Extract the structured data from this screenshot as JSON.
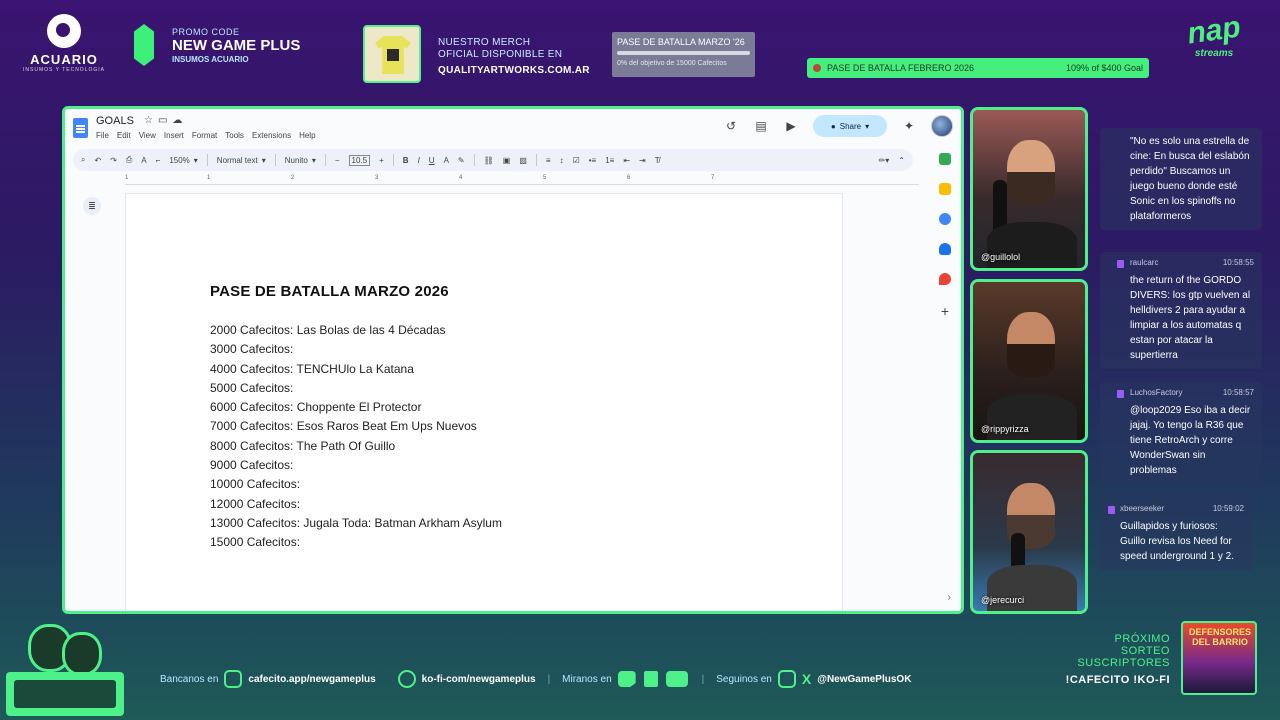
{
  "overlay": {
    "sponsor": {
      "name": "ACUARIO",
      "tagline": "INSUMOS Y TECNOLOGIA"
    },
    "promo": {
      "label": "PROMO CODE",
      "code": "NEW GAME PLUS",
      "sub": "INSUMOS ACUARIO"
    },
    "merch": {
      "line1": "NUESTRO MERCH",
      "line2": "OFICIAL DISPONIBLE EN",
      "url": "QUALITYARTWORKS.COM.AR"
    },
    "goal_card": {
      "title": "PASE DE BATALLA MARZO '26",
      "progress": 0,
      "status": "0% del objetivo de 15000 Cafecitos"
    },
    "goal_strip": {
      "title": "PASE DE BATALLA FEBRERO 2026",
      "amount": "109% of $400 Goal",
      "progress": 1.09
    },
    "brand": {
      "big": "nap",
      "small": "streams"
    }
  },
  "docs": {
    "title": "GOALS",
    "title_icons": [
      "star-icon",
      "folder-icon",
      "cloud-icon"
    ],
    "menu": [
      "File",
      "Edit",
      "View",
      "Insert",
      "Format",
      "Tools",
      "Extensions",
      "Help"
    ],
    "share_label": "Share",
    "toolbar": {
      "zoom": "150%",
      "style": "Normal text",
      "font": "Nunito",
      "font_size": "10.5"
    },
    "ruler_marks": [
      "1",
      "1",
      "2",
      "3",
      "4",
      "5",
      "6",
      "7"
    ],
    "heading": "PASE DE BATALLA MARZO 2026",
    "lines": [
      "2000 Cafecitos: Las Bolas de las 4 Décadas",
      "3000 Cafecitos:",
      "4000 Cafecitos: TENCHUlo La Katana",
      "5000 Cafecitos:",
      "6000 Cafecitos: Choppente El Protector",
      "7000 Cafecitos: Esos Raros Beat Em Ups Nuevos",
      "8000 Cafecitos: The Path Of Guillo",
      "9000 Cafecitos:",
      "10000 Cafecitos:",
      "12000 Cafecitos:",
      "13000 Cafecitos: Jugala Toda: Batman Arkham Asylum",
      "15000 Cafecitos:"
    ]
  },
  "cams": [
    {
      "handle": "@guillolol"
    },
    {
      "handle": "@rippyrizza"
    },
    {
      "handle": "@jerecurci"
    }
  ],
  "chat": [
    {
      "user": "",
      "time": "",
      "text": "\"No es solo una estrella de cine: En busca del eslabón perdido\" Buscamos un juego bueno donde esté Sonic en los spinoffs no plataformeros"
    },
    {
      "user": "raulcarc",
      "time": "10:58:55",
      "text": "the return of the GORDO DIVERS: los gtp vuelven al helldivers 2 para ayudar a limpiar a los automatas q estan por atacar la supertierra"
    },
    {
      "user": "LuchosFactory",
      "time": "10:58:57",
      "text": "@loop2029 Eso iba a decir jajaj. Yo tengo la R36 que tiene RetroArch y corre WonderSwan sin problemas"
    },
    {
      "user": "xbeerseeker",
      "time": "10:59:02",
      "text": "Guillapidos y furiosos: Guillo revisa los Need for speed underground 1 y 2."
    }
  ],
  "footer": {
    "bancanos": "Bancanos en",
    "cafecito": "cafecito.app/newgameplus",
    "kofi": "ko-fi-com/newgameplus",
    "miranos": "Miranos en",
    "separator": "|",
    "seguinos": "Seguinos en",
    "handle": "@NewGamePlusOK",
    "sorteo": [
      "PRÓXIMO",
      "SORTEO",
      "SUSCRIPTORES"
    ],
    "commands": "!CAFECITO  !KO-FI",
    "poster_title": "DEFENSORES DEL BARRIO"
  },
  "colors": {
    "accent": "#4ef08a",
    "doc_blue": "#4285f4",
    "share_bg": "#c2e7ff"
  }
}
